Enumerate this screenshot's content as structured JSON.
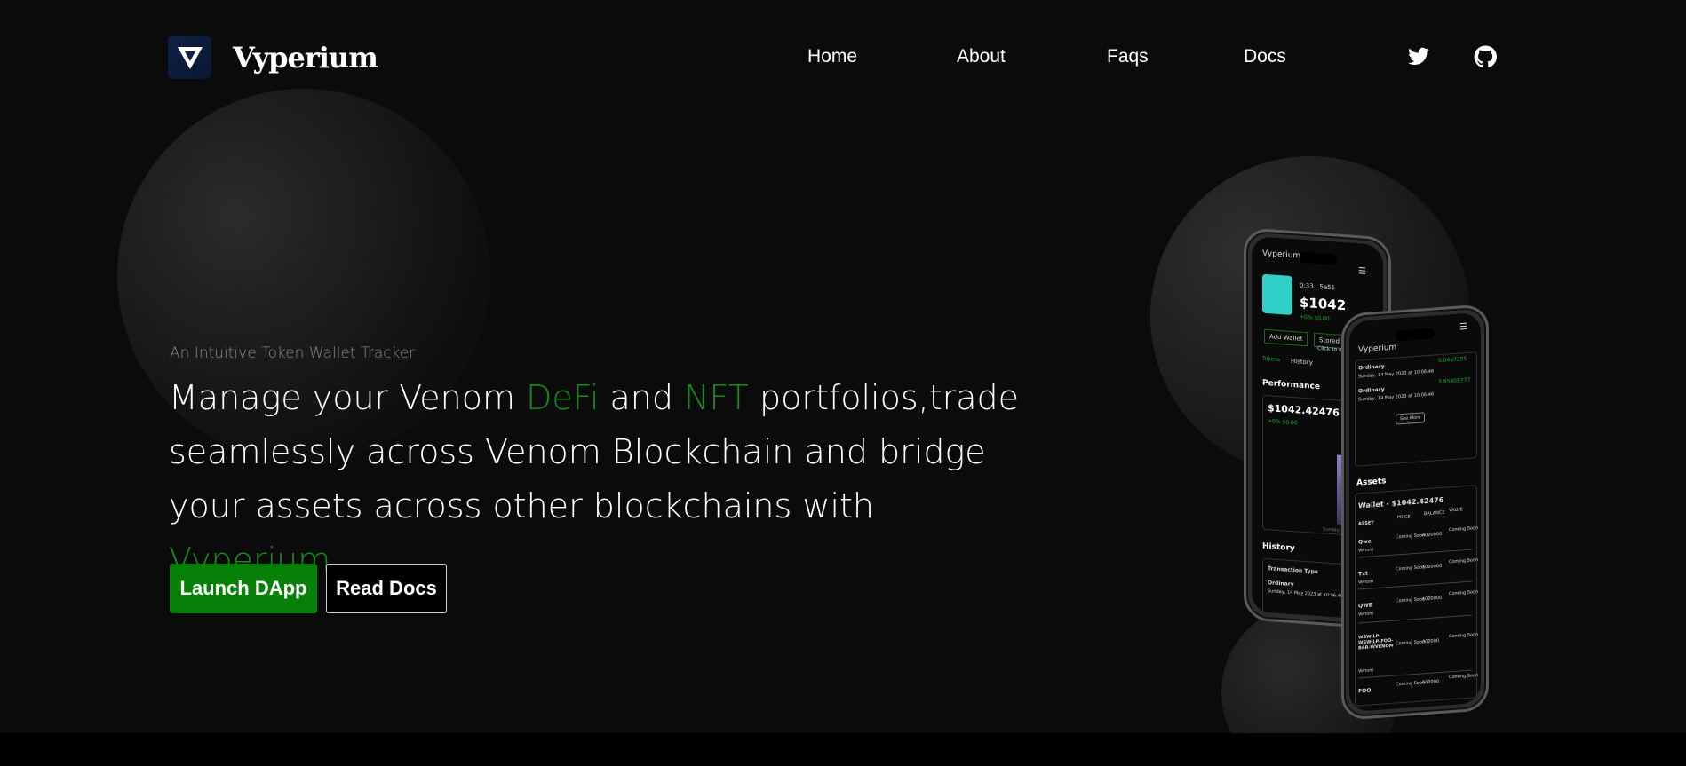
{
  "brand": {
    "name": "Vyperium",
    "logo_icon": "vyperium-v-logo"
  },
  "nav": {
    "items": [
      {
        "label": "Home"
      },
      {
        "label": "About"
      },
      {
        "label": "Faqs"
      },
      {
        "label": "Docs"
      }
    ],
    "social": {
      "twitter_icon": "twitter-icon",
      "github_icon": "github-icon"
    }
  },
  "hero": {
    "tagline": "An Intuitive Token Wallet Tracker",
    "headline": {
      "l1_a": "Manage your Venom ",
      "l1_b": "DeFi",
      "l1_c": " and ",
      "l1_d": "NFT",
      "l1_e": " portfolios,trade",
      "l2": "seamlessly across Venom Blockchain and bridge",
      "l3_a": "your assets across other blockchains with ",
      "l3_b": "Vyperium."
    },
    "primary_button": "Launch DApp",
    "secondary_button": "Read Docs"
  },
  "mockup": {
    "phone1": {
      "brand": "Vyperium",
      "address": "0:33...5e51",
      "balance": "$1042",
      "change": "+0% $0.00",
      "add_wallet": "Add Wallet",
      "stored_address": "Stored Address",
      "click_to_expand": "Click to expand",
      "tab_tokens": "Tokens",
      "tab_history": "History",
      "performance": "Performance",
      "perf_value": "$1042.42476",
      "perf_change": "+0% $0.00",
      "date_label": "Sunday 14 May",
      "history": "History",
      "transaction_type": "Transaction Type",
      "tx_type": "Ordinary",
      "tx_date": "Sunday, 14 May 2023 at 10:06:46"
    },
    "phone2": {
      "brand": "Vyperium",
      "rows": [
        {
          "type": "Ordinary",
          "date": "Sunday, 14 May 2023 at 10:06:46",
          "value": "0.0467295"
        },
        {
          "type": "Ordinary",
          "date": "Sunday, 14 May 2023 at 10:06:46",
          "value": "3.85409777"
        }
      ],
      "see_more": "See More",
      "assets": "Assets",
      "wallet_title": "Wallet - $1042.42476",
      "col_asset": "ASSET",
      "col_price": "PRICE",
      "col_balance": "BALANCE",
      "col_value": "VALUE",
      "assets_list": [
        {
          "name": "Qwe",
          "chain": "Venom",
          "price": "Coming Soon",
          "balance": "4000000",
          "value": "Coming Soon"
        },
        {
          "name": "Txt",
          "chain": "Venom",
          "price": "Coming Soon",
          "balance": "1000000",
          "value": "Coming Soon"
        },
        {
          "name": "QWE",
          "chain": "Venom",
          "price": "Coming Soon",
          "balance": "1000000",
          "value": "Coming Soon"
        },
        {
          "name": "WSW-LP-WSW-LP-FOO-BAR-WVENOM",
          "chain": "Venom",
          "price": "Coming Soon",
          "balance": "300000",
          "value": "Coming Soon"
        },
        {
          "name": "FOO",
          "chain": "",
          "price": "Coming Soon",
          "balance": "600000",
          "value": "Coming Soon"
        }
      ]
    }
  },
  "colors": {
    "accent_green": "#078007",
    "text_green": "#1a8a1a",
    "background": "#0b0b0b"
  }
}
